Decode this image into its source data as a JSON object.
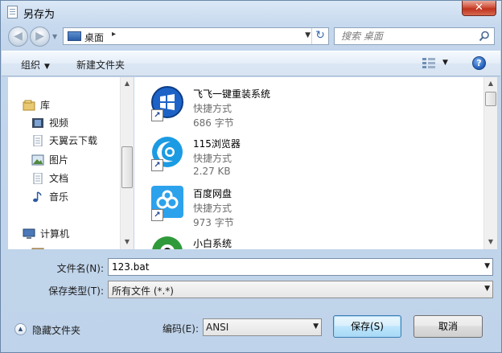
{
  "window": {
    "title": "另存为",
    "close_label": "✕"
  },
  "address": {
    "location": "桌面",
    "separator": "▸",
    "refresh": "↻"
  },
  "search": {
    "placeholder": "搜索 桌面"
  },
  "toolbar": {
    "organize_label": "组织",
    "new_folder_label": "新建文件夹",
    "help_label": "?"
  },
  "sidebar": {
    "items": [
      {
        "label": "库",
        "icon": "library-icon"
      },
      {
        "label": "视频",
        "icon": "video-icon"
      },
      {
        "label": "天翼云下载",
        "icon": "document-icon"
      },
      {
        "label": "图片",
        "icon": "picture-icon"
      },
      {
        "label": "文档",
        "icon": "document-icon"
      },
      {
        "label": "音乐",
        "icon": "music-icon"
      },
      {
        "label": "计算机",
        "icon": "computer-icon"
      }
    ]
  },
  "files": [
    {
      "name": "飞飞一键重装系统",
      "type": "快捷方式",
      "size": "686 字节",
      "icon": "windows-logo-icon"
    },
    {
      "name": "115浏览器",
      "type": "快捷方式",
      "size": "2.27 KB",
      "icon": "browser-115-icon"
    },
    {
      "name": "百度网盘",
      "type": "快捷方式",
      "size": "973 字节",
      "icon": "baidu-netdisk-icon"
    },
    {
      "name": "小白系统",
      "type": "",
      "size": "",
      "icon": "xiaobai-icon"
    }
  ],
  "form": {
    "filename_label": "文件名(N):",
    "filename_value": "123.bat",
    "filetype_label": "保存类型(T):",
    "filetype_value": "所有文件 (*.*)",
    "hide_folders_label": "隐藏文件夹",
    "encoding_label": "编码(E):",
    "encoding_value": "ANSI",
    "save_label": "保存(S)",
    "cancel_label": "取消"
  }
}
